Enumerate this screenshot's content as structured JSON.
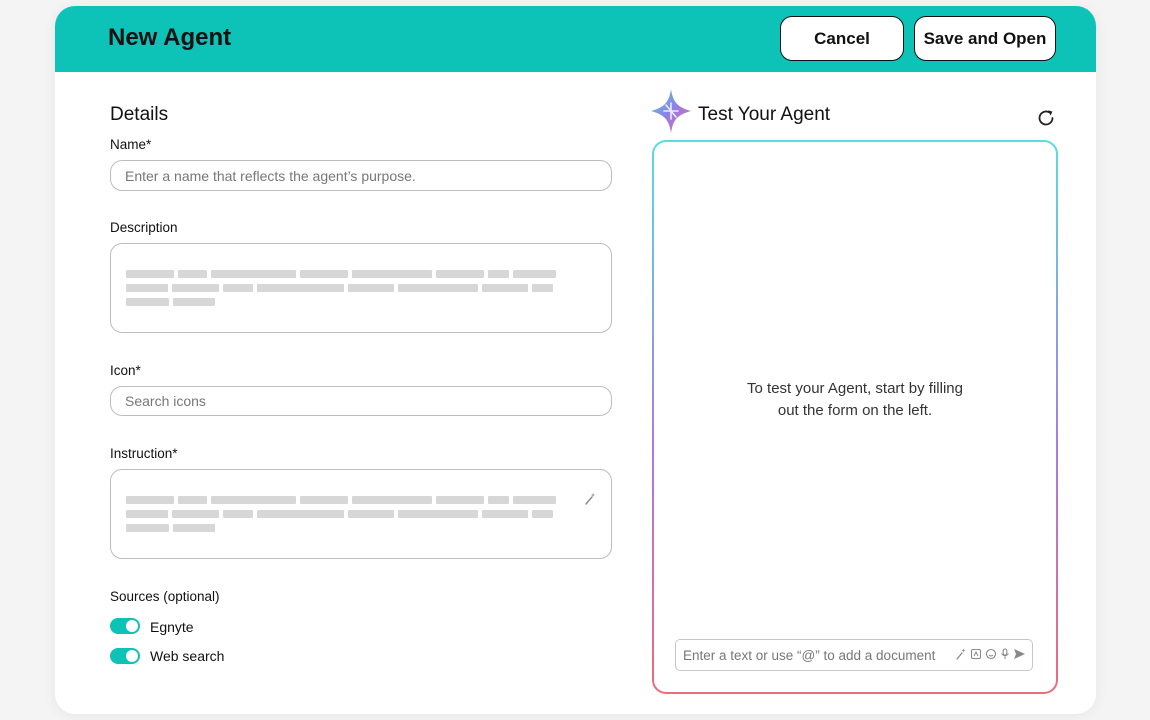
{
  "header": {
    "title": "New Agent",
    "cancel_label": "Cancel",
    "save_label": "Save and Open"
  },
  "details": {
    "title": "Details",
    "name": {
      "label": "Name*",
      "placeholder": "Enter a name that reflects the agent’s purpose."
    },
    "description": {
      "label": "Description"
    },
    "icon": {
      "label": "Icon*",
      "placeholder": "Search icons"
    },
    "instruction": {
      "label": "Instruction*"
    },
    "sources": {
      "label": "Sources (optional)",
      "items": [
        {
          "label": "Egnyte",
          "enabled": true
        },
        {
          "label": "Web search",
          "enabled": true
        }
      ]
    }
  },
  "test": {
    "title": "Test Your Agent",
    "empty_message_line1": "To test your Agent, start by filling",
    "empty_message_line2": "out the form on the left.",
    "chat_placeholder": "Enter a text or use “@” to add a document"
  },
  "colors": {
    "header": "#0dc3b8",
    "toggle_on": "#0dc3b8",
    "panel_gradient": [
      "#55dfe0",
      "#a77ddf",
      "#f06a7a"
    ]
  },
  "icons": [
    "sparkle-logo-icon",
    "refresh-icon",
    "magic-wand-icon",
    "attachment-icon",
    "emoji-icon",
    "microphone-icon",
    "send-icon"
  ]
}
